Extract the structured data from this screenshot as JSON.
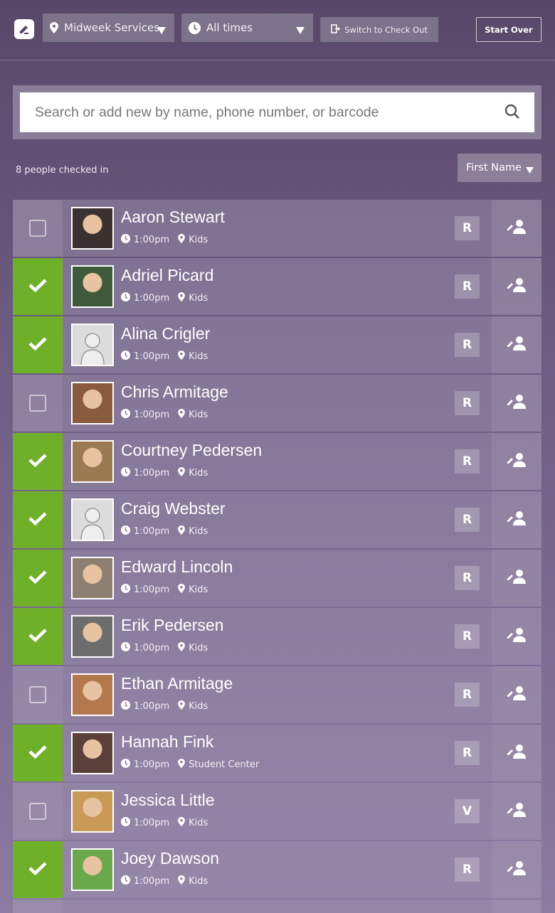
{
  "header": {
    "service_label": "Midweek Services",
    "times_label": "All times",
    "switch_label": "Switch to Check Out",
    "start_over_label": "Start Over"
  },
  "search": {
    "placeholder": "Search or add new by name, phone number, or barcode"
  },
  "summary": {
    "count_text": "8 people checked in",
    "sort_label": "First Name"
  },
  "people": [
    {
      "name": "Aaron Stewart",
      "time": "1:00pm",
      "location": "Kids",
      "badge": "R",
      "checked": false,
      "avatar": "photo",
      "color": "#3a3230"
    },
    {
      "name": "Adriel Picard",
      "time": "1:00pm",
      "location": "Kids",
      "badge": "R",
      "checked": true,
      "avatar": "photo",
      "color": "#3f5a3a"
    },
    {
      "name": "Alina Crigler",
      "time": "1:00pm",
      "location": "Kids",
      "badge": "R",
      "checked": true,
      "avatar": "placeholder",
      "color": "#d9d9d9"
    },
    {
      "name": "Chris Armitage",
      "time": "1:00pm",
      "location": "Kids",
      "badge": "R",
      "checked": false,
      "avatar": "photo",
      "color": "#8a5a3c"
    },
    {
      "name": "Courtney Pedersen",
      "time": "1:00pm",
      "location": "Kids",
      "badge": "R",
      "checked": true,
      "avatar": "photo",
      "color": "#9a7a52"
    },
    {
      "name": "Craig Webster",
      "time": "1:00pm",
      "location": "Kids",
      "badge": "R",
      "checked": true,
      "avatar": "placeholder",
      "color": "#d9d9d9"
    },
    {
      "name": "Edward Lincoln",
      "time": "1:00pm",
      "location": "Kids",
      "badge": "R",
      "checked": true,
      "avatar": "photo",
      "color": "#8c7e70"
    },
    {
      "name": "Erik Pedersen",
      "time": "1:00pm",
      "location": "Kids",
      "badge": "R",
      "checked": true,
      "avatar": "photo",
      "color": "#6d6d6d"
    },
    {
      "name": "Ethan Armitage",
      "time": "1:00pm",
      "location": "Kids",
      "badge": "R",
      "checked": false,
      "avatar": "photo",
      "color": "#b4784e"
    },
    {
      "name": "Hannah Fink",
      "time": "1:00pm",
      "location": "Student Center",
      "badge": "R",
      "checked": true,
      "avatar": "photo",
      "color": "#5a4038"
    },
    {
      "name": "Jessica Little",
      "time": "1:00pm",
      "location": "Kids",
      "badge": "V",
      "checked": false,
      "avatar": "photo",
      "color": "#c89a56"
    },
    {
      "name": "Joey Dawson",
      "time": "1:00pm",
      "location": "Kids",
      "badge": "R",
      "checked": true,
      "avatar": "photo",
      "color": "#6aa84c"
    }
  ],
  "colors": {
    "checked_green": "#6fb02b",
    "background_top": "#584868",
    "background_bottom": "#8d7aa3"
  }
}
